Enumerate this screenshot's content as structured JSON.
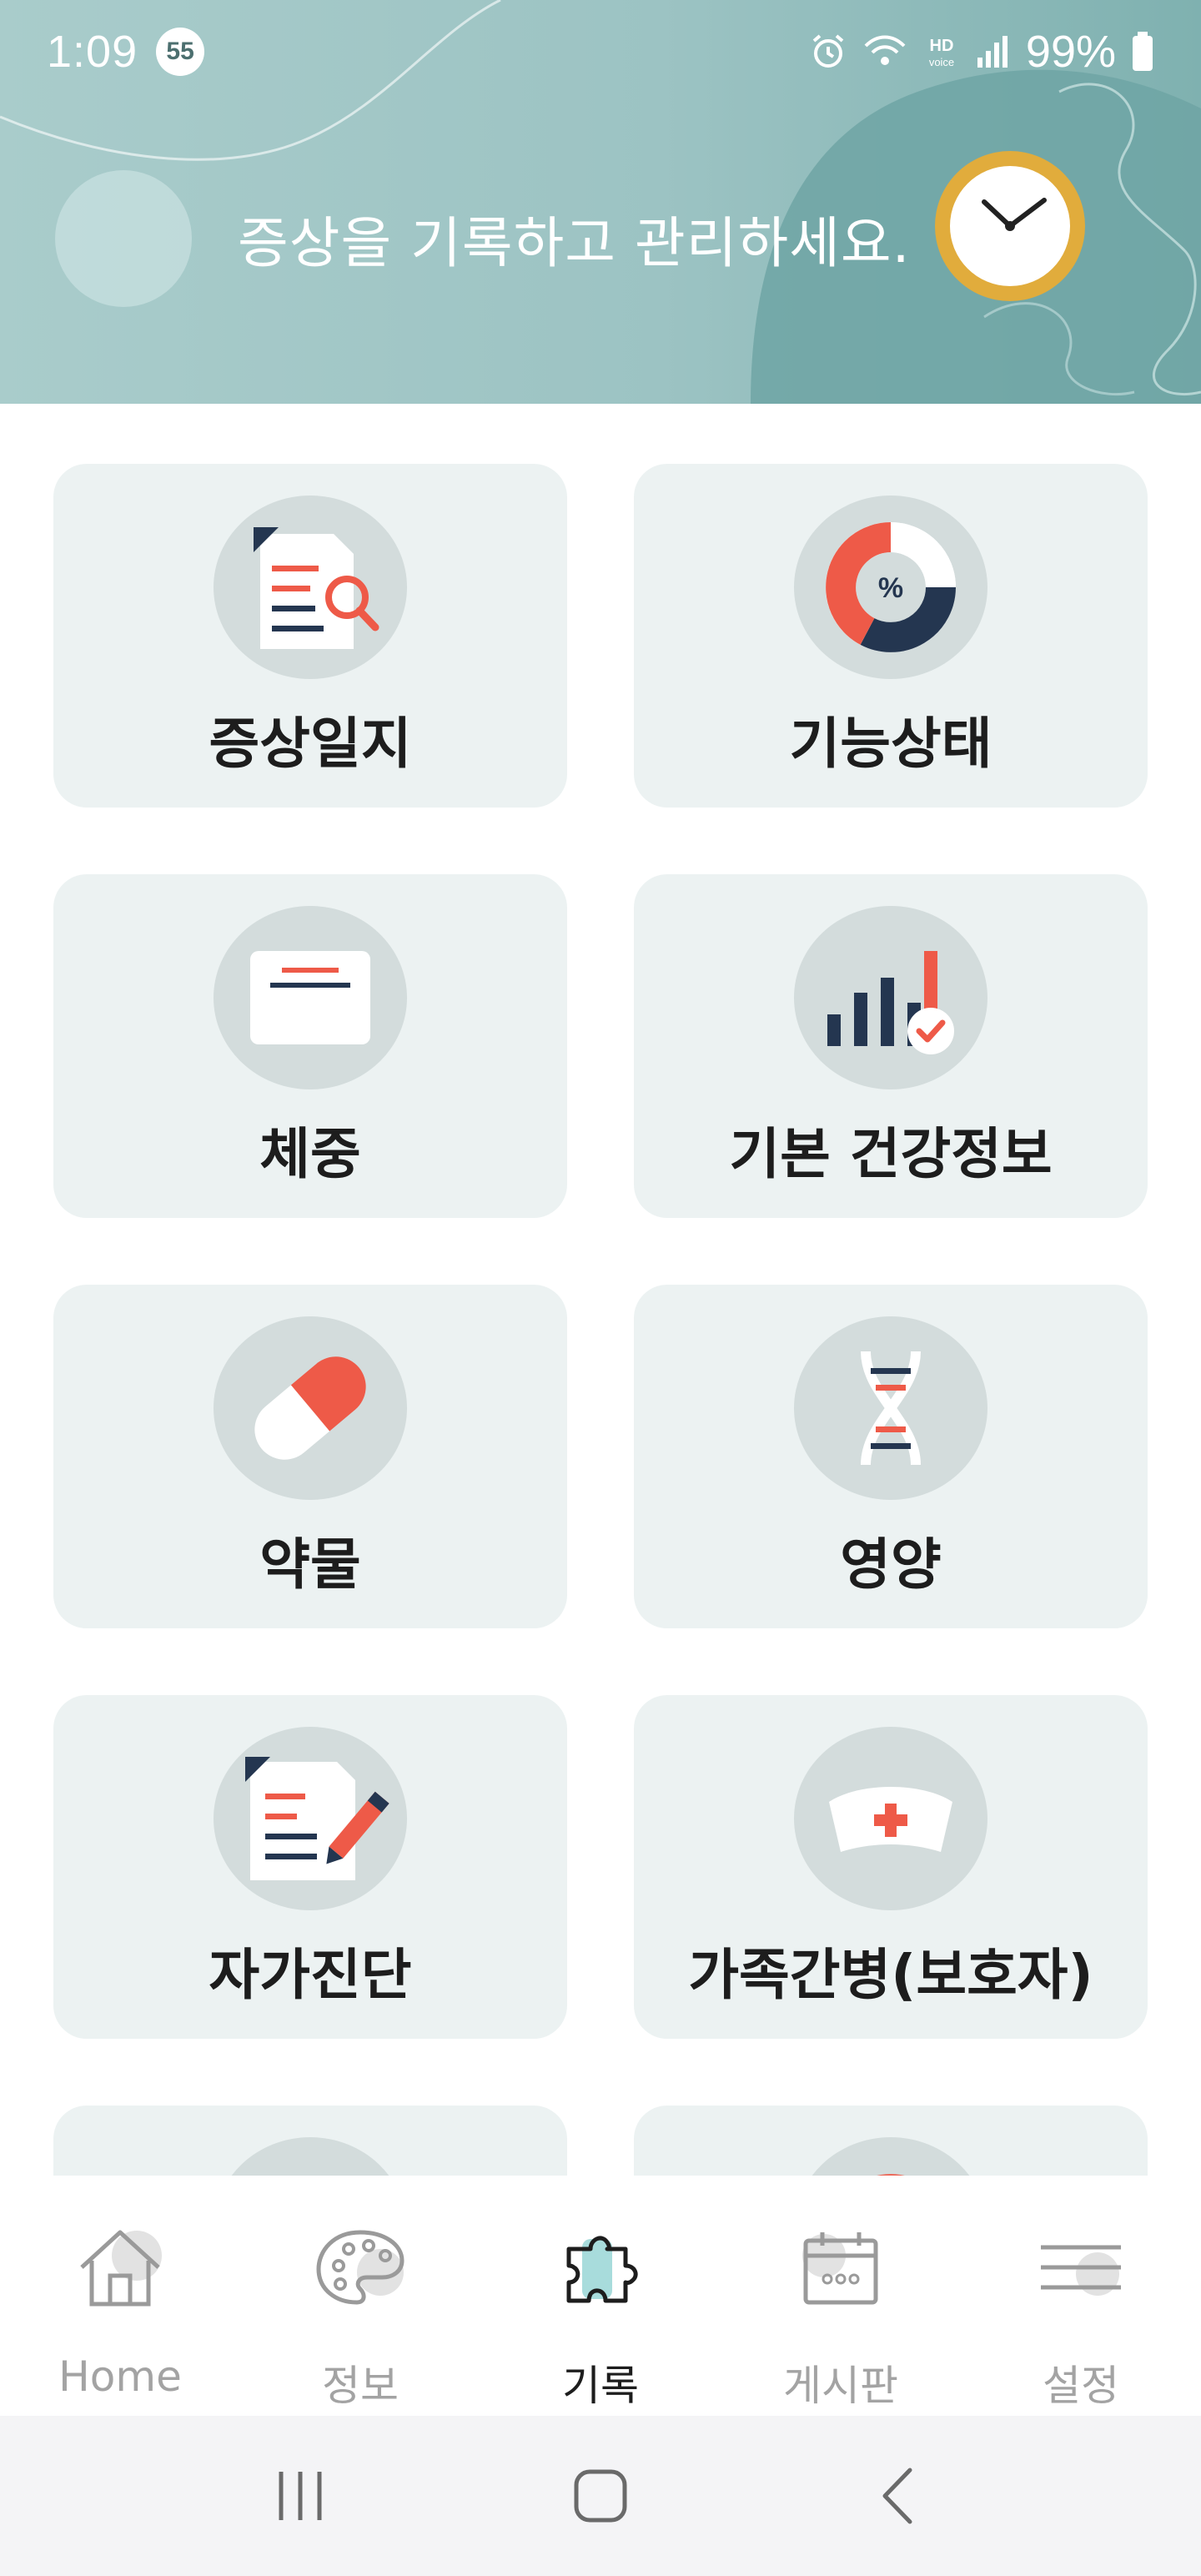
{
  "status_bar": {
    "time": "1:09",
    "notification_count": "55",
    "battery": "99%",
    "icons": [
      "alarm-icon",
      "wifi-icon",
      "hd-voice-icon",
      "signal-icon",
      "battery-icon"
    ]
  },
  "header": {
    "title": "증상을 기록하고 관리하세요.",
    "icon": "clock-icon"
  },
  "cards": [
    {
      "label": "증상일지",
      "icon": "document-search-icon"
    },
    {
      "label": "기능상태",
      "icon": "percent-donut-icon"
    },
    {
      "label": "체중",
      "icon": "scale-icon"
    },
    {
      "label": "기본 건강정보",
      "icon": "bar-chart-check-icon"
    },
    {
      "label": "약물",
      "icon": "pill-icon"
    },
    {
      "label": "영양",
      "icon": "dna-icon"
    },
    {
      "label": "자가진단",
      "icon": "document-pen-icon"
    },
    {
      "label": "가족간병(보호자)",
      "icon": "nurse-cap-icon"
    }
  ],
  "bottom_nav": {
    "items": [
      {
        "label": "Home",
        "icon": "home-icon",
        "active": false
      },
      {
        "label": "정보",
        "icon": "palette-icon",
        "active": false
      },
      {
        "label": "기록",
        "icon": "puzzle-icon",
        "active": true
      },
      {
        "label": "게시판",
        "icon": "calendar-icon",
        "active": false
      },
      {
        "label": "설정",
        "icon": "menu-icon",
        "active": false
      }
    ]
  },
  "system_nav": {
    "icons": [
      "recent-apps-icon",
      "home-button-icon",
      "back-icon"
    ]
  },
  "colors": {
    "header_bg": "#9cc3c3",
    "card_bg": "#ecf2f2",
    "icon_blob": "#d3dcdc",
    "accent_red": "#ee5a48",
    "navy": "#243650",
    "clock_ring": "#e1ac3c"
  }
}
